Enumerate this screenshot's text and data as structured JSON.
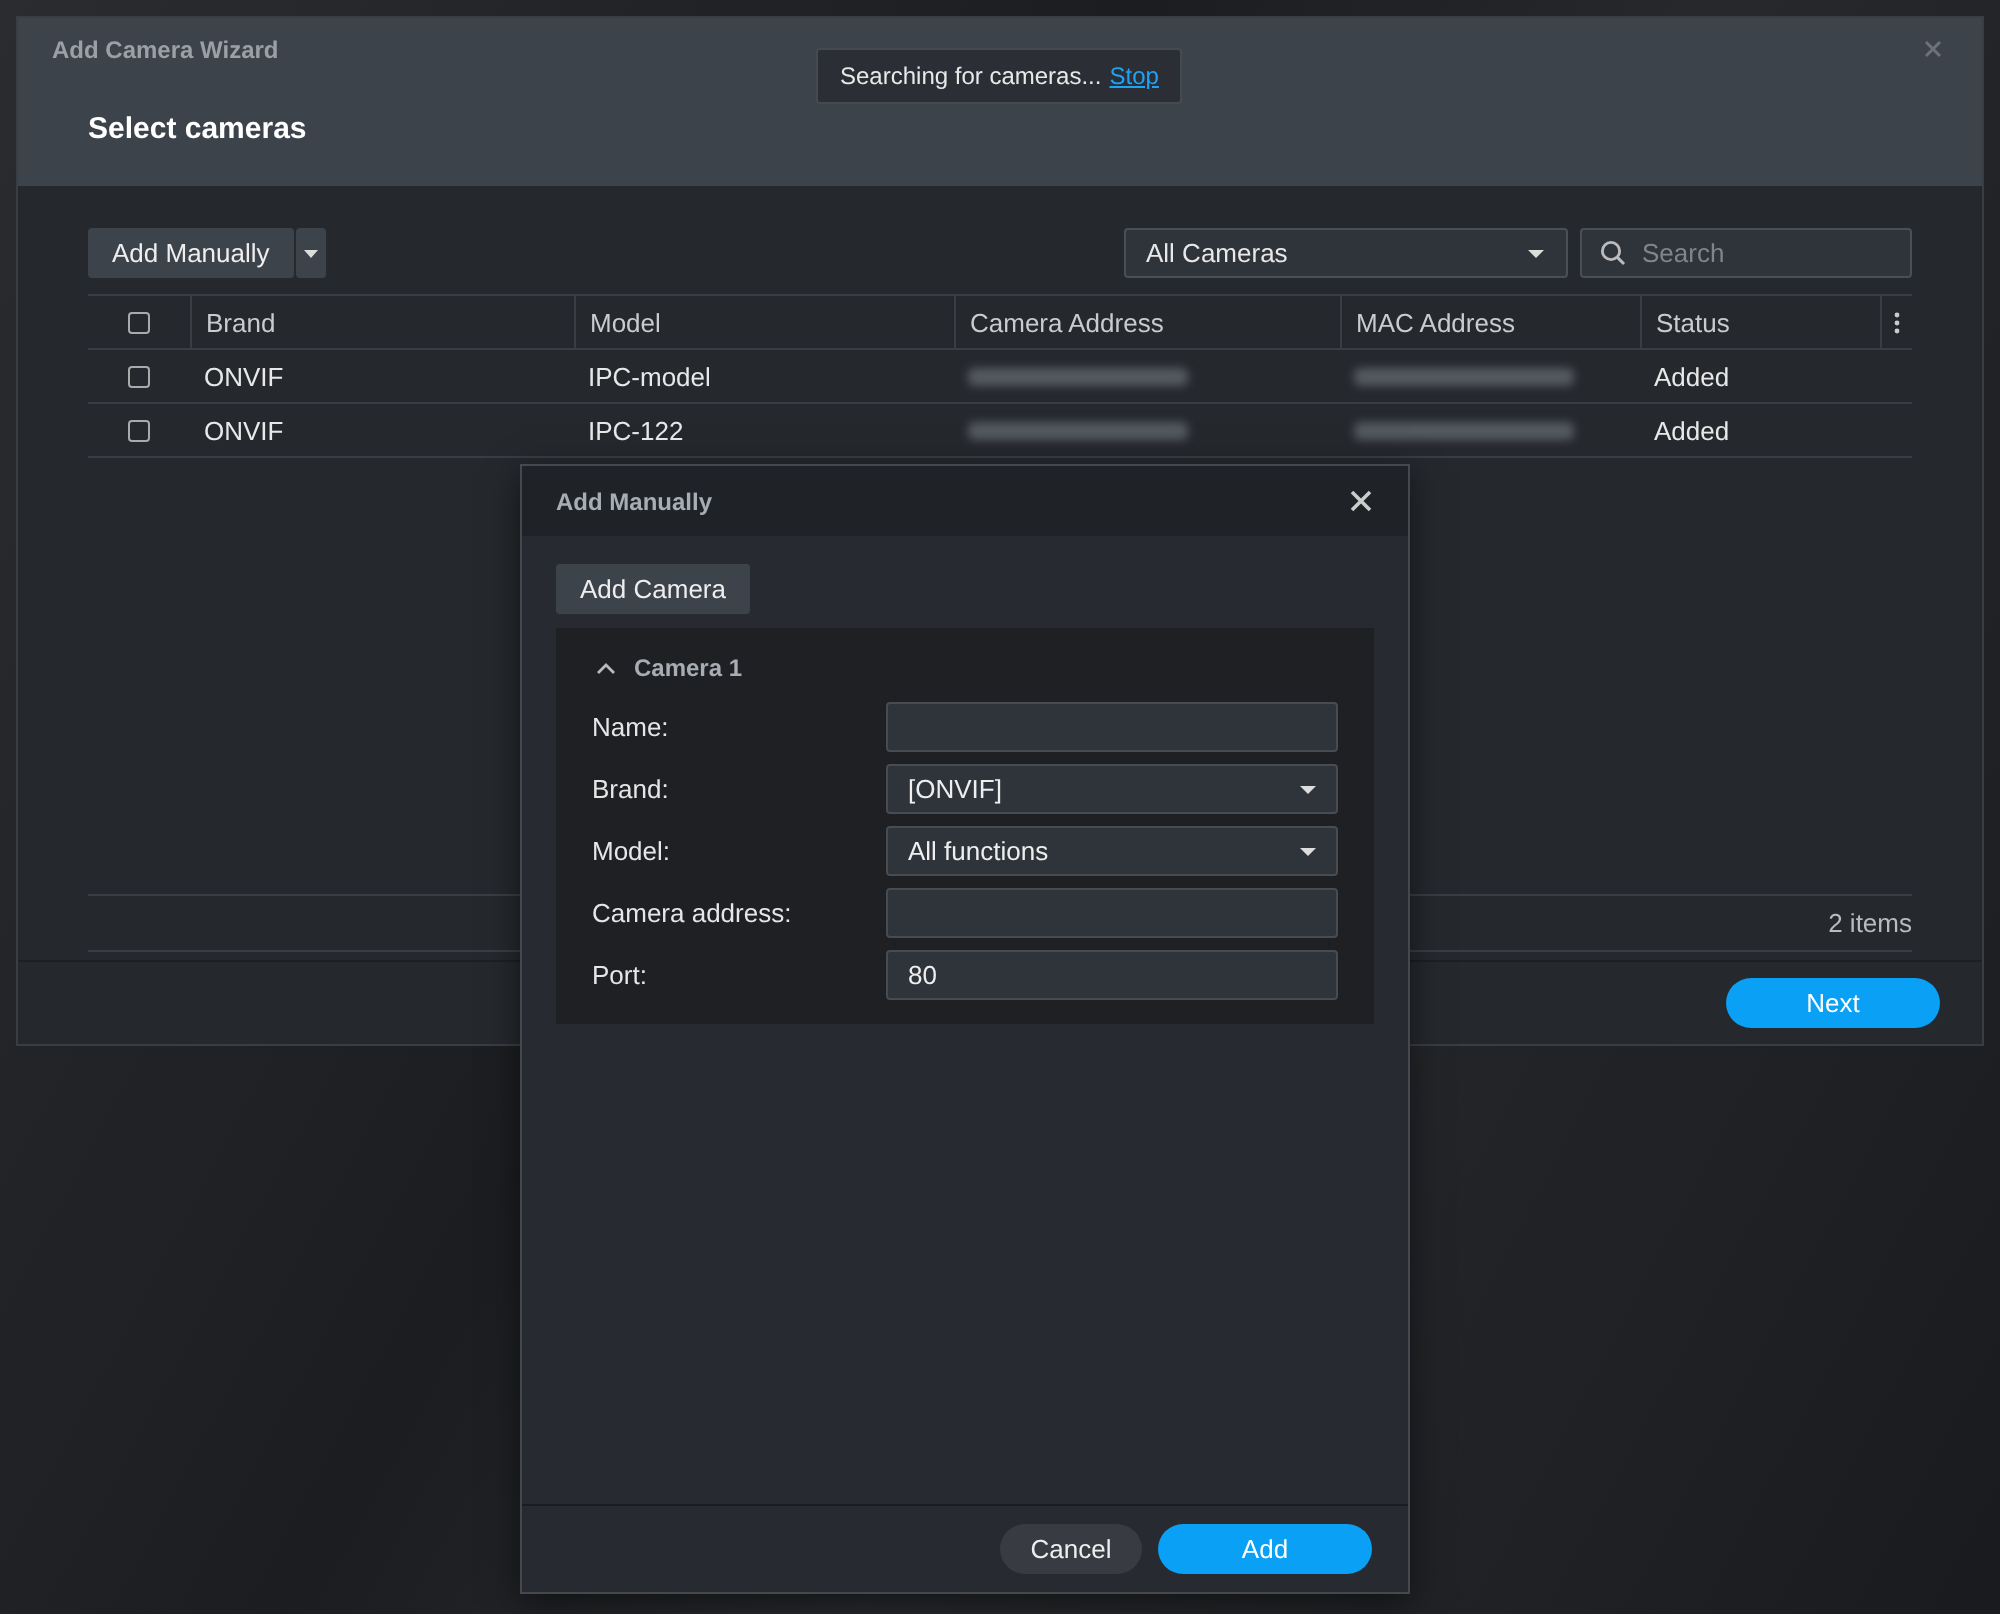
{
  "wizard": {
    "title": "Add Camera Wizard",
    "heading": "Select cameras",
    "toast": {
      "text": "Searching for cameras...",
      "link": "Stop"
    },
    "toolbar": {
      "add_button": "Add Manually",
      "filter": "All Cameras",
      "search": {
        "placeholder": "Search"
      }
    },
    "table": {
      "select_all": {
        "checked": false
      },
      "columns": [
        "Brand",
        "Model",
        "Camera Address",
        "MAC Address",
        "Status"
      ],
      "rows": [
        {
          "checked": false,
          "brand": "ONVIF",
          "model": "IPC-model",
          "status": "Added"
        },
        {
          "checked": false,
          "brand": "ONVIF",
          "model": "IPC-122",
          "status": "Added"
        }
      ]
    },
    "item_count": "2 items",
    "next_button": "Next"
  },
  "dialog": {
    "title": "Add Manually",
    "add_camera_button": "Add Camera",
    "section": {
      "title": "Camera 1",
      "expanded": true,
      "fields": [
        {
          "kind": "text",
          "label": "Name:"
        },
        {
          "kind": "select",
          "label": "Brand:",
          "value": "[ONVIF]"
        },
        {
          "kind": "select",
          "label": "Model:",
          "value": "All functions"
        },
        {
          "kind": "text",
          "label": "Camera address:"
        },
        {
          "kind": "text",
          "label": "Port:",
          "value": "80"
        }
      ]
    },
    "buttons": [
      {
        "label": "Cancel",
        "primary": false
      },
      {
        "label": "Add",
        "primary": true
      }
    ]
  }
}
